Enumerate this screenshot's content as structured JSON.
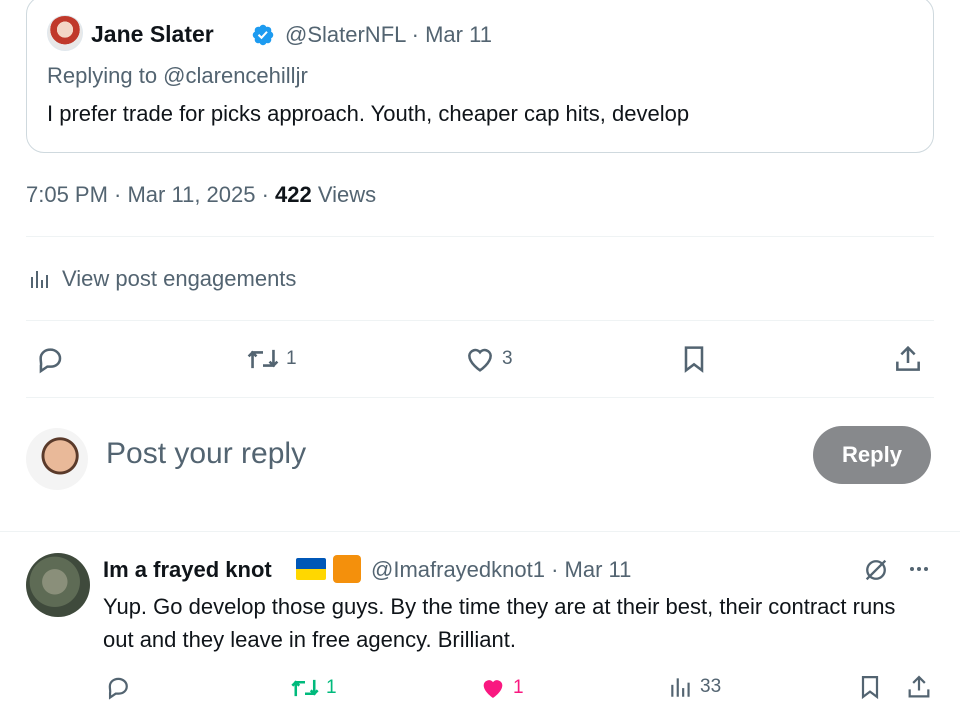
{
  "quoted_post": {
    "author_name": "Jane Slater",
    "handle_date": "@SlaterNFL · Mar 11",
    "replying_to": "Replying to @clarencehilljr",
    "text": "I prefer trade for picks approach. Youth, cheaper cap hits, develop"
  },
  "post_meta": {
    "time_date": "7:05 PM · Mar 11, 2025 · ",
    "views_count": "422",
    "views_label": " Views"
  },
  "engagements": {
    "label": "View post engagements"
  },
  "actions": {
    "retweets": "1",
    "likes": "3"
  },
  "reply_composer": {
    "placeholder": "Post your reply",
    "button_label": "Reply"
  },
  "reply": {
    "author_name": "Im a frayed knot",
    "handle_date": "@Imafrayedknot1 · Mar 11",
    "text": "Yup. Go develop those guys. By the time they are at their best, their contract runs out and they leave in free agency. Brilliant.",
    "retweets": "1",
    "likes": "1",
    "views": "33"
  },
  "colors": {
    "verified": "#1d9bf0",
    "retweet_active": "#00ba7c",
    "like_active": "#f91880",
    "secondary_text": "#536471",
    "reply_button_disabled": "#87898c"
  },
  "icons": [
    "verified-badge-icon",
    "analytics-icon",
    "reply-icon",
    "retweet-icon",
    "like-icon",
    "bookmark-icon",
    "share-icon",
    "grok-icon",
    "more-icon"
  ]
}
